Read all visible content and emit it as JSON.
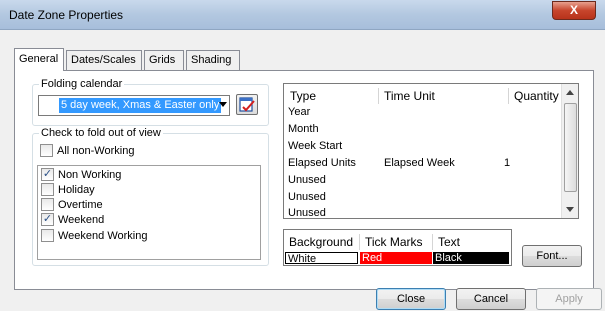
{
  "window": {
    "title": "Date Zone Properties",
    "close_glyph": "X"
  },
  "tabs": [
    {
      "label": "General",
      "active": true
    },
    {
      "label": "Dates/Scales",
      "active": false
    },
    {
      "label": "Grids",
      "active": false
    },
    {
      "label": "Shading",
      "active": false
    }
  ],
  "folding_calendar": {
    "group_label": "Folding calendar",
    "selected": "5 day week, Xmas & Easter only"
  },
  "fold": {
    "group_label": "Check to fold out of view",
    "all_non_working": {
      "label": "All non-Working",
      "checked": false
    },
    "items": [
      {
        "label": "Non Working",
        "checked": true
      },
      {
        "label": "Holiday",
        "checked": false
      },
      {
        "label": "Overtime",
        "checked": false
      },
      {
        "label": "Weekend",
        "checked": true
      },
      {
        "label": "Weekend Working",
        "checked": false
      }
    ]
  },
  "scale_table": {
    "columns": [
      "Type",
      "Time Unit",
      "Quantity"
    ],
    "rows": [
      {
        "type": "Year",
        "time_unit": "",
        "quantity": ""
      },
      {
        "type": "Month",
        "time_unit": "",
        "quantity": ""
      },
      {
        "type": "Week Start",
        "time_unit": "",
        "quantity": ""
      },
      {
        "type": "Elapsed Units",
        "time_unit": "Elapsed Week",
        "quantity": "1"
      },
      {
        "type": "Unused",
        "time_unit": "",
        "quantity": ""
      },
      {
        "type": "Unused",
        "time_unit": "",
        "quantity": ""
      },
      {
        "type": "Unused",
        "time_unit": "",
        "quantity": ""
      }
    ]
  },
  "colors": {
    "columns": [
      "Background",
      "Tick Marks",
      "Text"
    ],
    "values": [
      {
        "label": "White",
        "bg": "#ffffff",
        "fg": "#000000"
      },
      {
        "label": "Red",
        "bg": "#ff0000",
        "fg": "#ffffff"
      },
      {
        "label": "Black",
        "bg": "#000000",
        "fg": "#ffffff"
      }
    ]
  },
  "buttons": {
    "font": "Font...",
    "close": "Close",
    "cancel": "Cancel",
    "apply": "Apply"
  },
  "icons": {
    "edit_calendar": "edit-calendar-icon",
    "dropdown": "chevron-down-icon",
    "check": "✓"
  }
}
